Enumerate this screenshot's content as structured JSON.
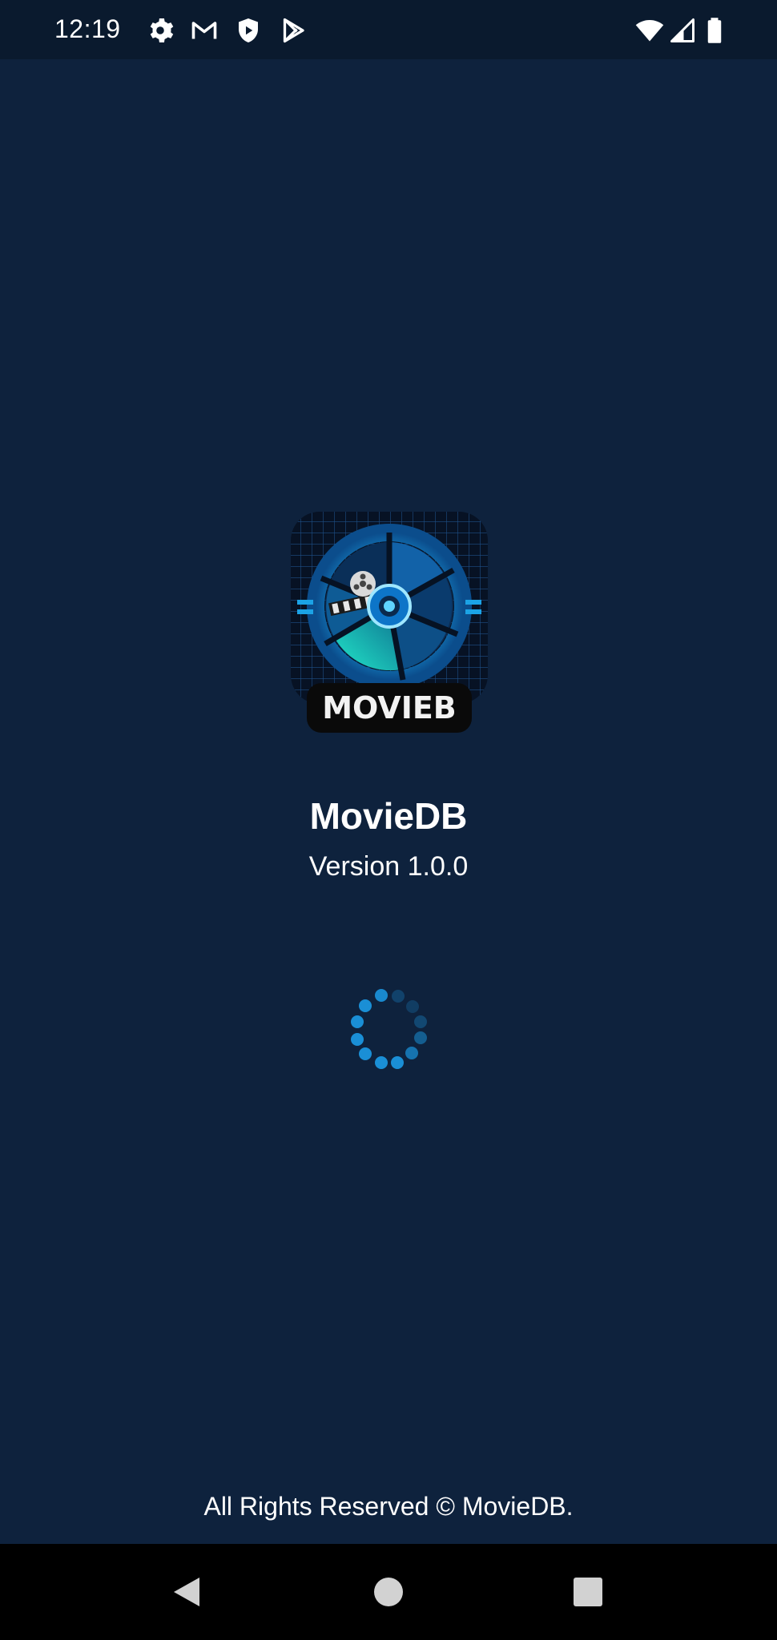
{
  "status_bar": {
    "time": "12:19",
    "icons_left": [
      "settings-icon",
      "gmail-icon",
      "shield-icon",
      "play-store-icon"
    ],
    "icons_right": [
      "wifi-icon",
      "signal-icon",
      "battery-icon"
    ]
  },
  "splash": {
    "logo_text": "MOVIEB",
    "app_name": "MovieDB",
    "version": "Version 1.0.0",
    "footer": "All Rights Reserved © MovieDB."
  },
  "navigation": {
    "buttons": [
      "back-icon",
      "home-icon",
      "recents-icon"
    ]
  },
  "colors": {
    "background": "#0e223d",
    "status_bar": "#0a1a2e",
    "nav_bar": "#000000",
    "accent": "#1a8fd6",
    "text": "#ffffff"
  }
}
